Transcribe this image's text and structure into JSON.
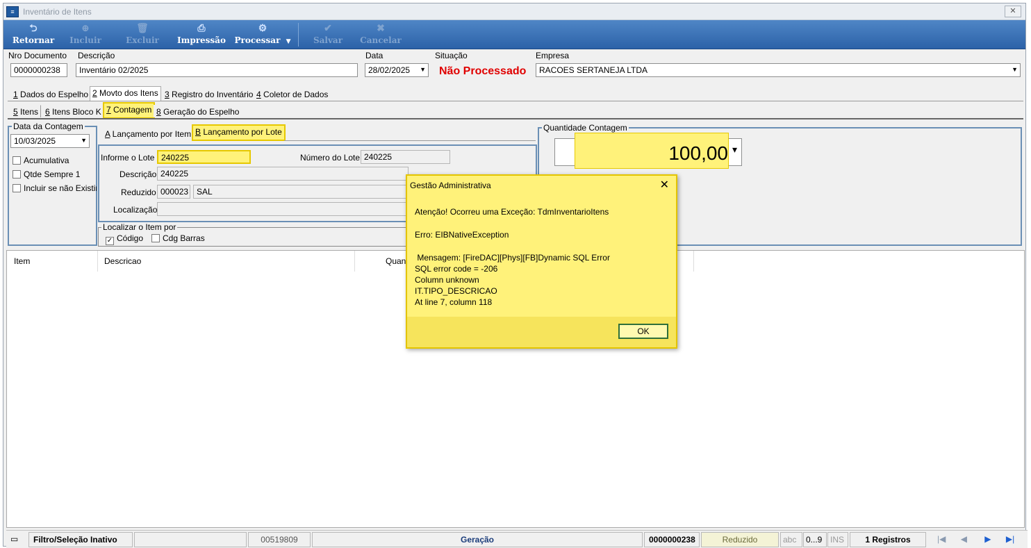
{
  "window": {
    "title": "Inventário de Itens",
    "close_symbol": "🗙"
  },
  "toolbar": {
    "retornar": "Retornar",
    "incluir": "Incluir",
    "excluir": "Excluir",
    "impressao": "Impressão",
    "processar": "Processar",
    "salvar": "Salvar",
    "cancelar": "Cancelar"
  },
  "header": {
    "nro_documento_label": "Nro Documento",
    "nro_documento": "0000000238",
    "descricao_label": "Descrição",
    "descricao": "Inventário 02/2025",
    "data_label": "Data",
    "data": "28/02/2025",
    "situacao_label": "Situação",
    "situacao": "Não Processado",
    "empresa_label": "Empresa",
    "empresa": "RACOES SERTANEJA LTDA"
  },
  "tabs1": [
    {
      "key": "1",
      "label": " Dados do Espelho"
    },
    {
      "key": "2",
      "label": " Movto dos Itens"
    },
    {
      "key": "3",
      "label": " Registro do Inventário"
    },
    {
      "key": "4",
      "label": " Coletor de Dados"
    }
  ],
  "tabs2": [
    {
      "key": "5",
      "label": " Itens"
    },
    {
      "key": "6",
      "label": " Itens Bloco K"
    },
    {
      "key": "7",
      "label": " Contagem"
    },
    {
      "key": "8",
      "label": " Geração do Espelho"
    }
  ],
  "contagem": {
    "data_label": "Data da Contagem",
    "data": "10/03/2025",
    "acumulativa": "Acumulativa",
    "qtde_sempre": "Qtde Sempre 1",
    "incluir_nao_existir": "Incluir se não Existir"
  },
  "lanc_tabs": [
    {
      "key": "A",
      "label": " Lançamento por Item"
    },
    {
      "key": "B",
      "label": " Lançamento por Lote"
    }
  ],
  "lote": {
    "informe_label": "Informe o Lote",
    "informe": "240225",
    "numero_label": "Número do Lote",
    "numero": "240225",
    "descricao_label": "Descrição",
    "descricao": "240225",
    "reduzido_label": "Reduzido",
    "reduzido": "000023",
    "reduzido_nome": "SAL",
    "localizacao_label": "Localização",
    "localizar_label": "Localizar o Item por",
    "codigo": "Código",
    "cdg_barras": "Cdg Barras"
  },
  "quantidade": {
    "label": "Quantidade Contagem",
    "value": "100,00"
  },
  "grid": {
    "columns": [
      "Item",
      "Descricao",
      "Quanti"
    ]
  },
  "dialog": {
    "title": "Gestão Administrativa",
    "line1": "Atenção! Ocorreu uma Exceção: TdmInventarioItens",
    "line2": "Erro: EIBNativeException",
    "line3": " Mensagem: [FireDAC][Phys][FB]Dynamic SQL Error\nSQL error code = -206\nColumn unknown\nIT.TIPO_DESCRICAO\nAt line 7, column 118",
    "ok": "OK"
  },
  "status": {
    "filtro": "Filtro/Seleção Inativo",
    "codigo": "00519809",
    "geracao": "Geração",
    "documento": "0000000238",
    "reduzido": "Reduzido",
    "abc": "abc",
    "num": "0...9",
    "ins": "INS",
    "registros": "1 Registros"
  }
}
